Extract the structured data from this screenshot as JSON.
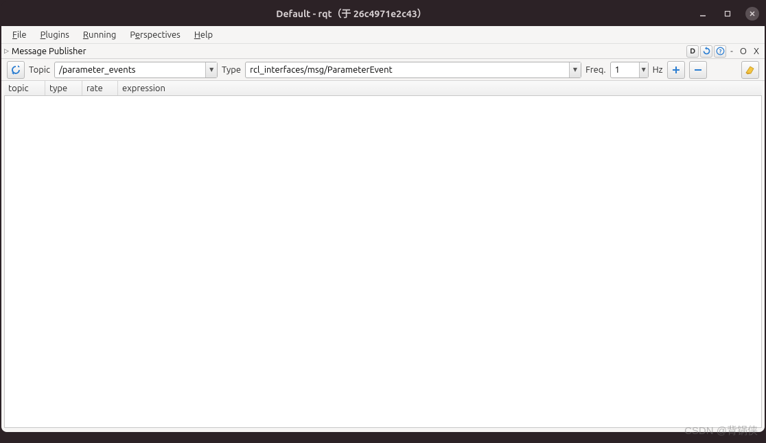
{
  "window": {
    "title": "Default - rqt（于 26c4971e2c43）"
  },
  "menubar": {
    "file": "File",
    "plugins": "Plugins",
    "running": "Running",
    "perspectives": "Perspectives",
    "help": "Help"
  },
  "plugin": {
    "title": "Message Publisher",
    "header_buttons": {
      "d": "D",
      "minus": "-",
      "o": "O",
      "x": "X"
    }
  },
  "toolbar": {
    "topic_label": "Topic",
    "topic_value": "/parameter_events",
    "type_label": "Type",
    "type_value": "rcl_interfaces/msg/ParameterEvent",
    "freq_label": "Freq.",
    "freq_value": "1",
    "hz_label": "Hz"
  },
  "table": {
    "columns": {
      "topic": "topic",
      "type": "type",
      "rate": "rate",
      "expression": "expression"
    }
  },
  "watermark": "CSDN @背锅侠"
}
